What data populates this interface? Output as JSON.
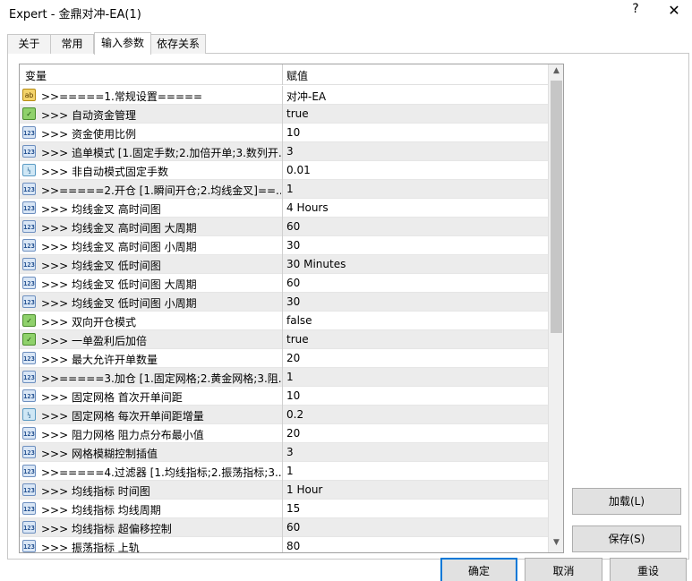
{
  "window": {
    "title": "Expert - 金鼎对冲-EA(1)",
    "help_label": "?",
    "close_label": "✕"
  },
  "tabs": [
    {
      "label": "关于"
    },
    {
      "label": "常用"
    },
    {
      "label": "输入参数"
    },
    {
      "label": "依存关系"
    }
  ],
  "table": {
    "col_variable": "变量",
    "col_value": "赋值",
    "rows": [
      {
        "type": "string",
        "name": ">>=====1.常规设置=====",
        "value": "对冲-EA"
      },
      {
        "type": "bool",
        "name": ">>>  自动资金管理",
        "value": "true"
      },
      {
        "type": "int",
        "name": ">>>  资金使用比例",
        "value": "10"
      },
      {
        "type": "int",
        "name": ">>>  追单模式 [1.固定手数;2.加倍开单;3.数列开...",
        "value": "3"
      },
      {
        "type": "double",
        "name": ">>>  非自动模式固定手数",
        "value": "0.01"
      },
      {
        "type": "int",
        "name": ">>=====2.开仓 [1.瞬间开仓;2.均线金叉]==...",
        "value": "1"
      },
      {
        "type": "int",
        "name": ">>>  均线金叉 高时间图",
        "value": "4 Hours"
      },
      {
        "type": "int",
        "name": ">>>  均线金叉 高时间图 大周期",
        "value": "60"
      },
      {
        "type": "int",
        "name": ">>>  均线金叉 高时间图 小周期",
        "value": "30"
      },
      {
        "type": "int",
        "name": ">>>  均线金叉 低时间图",
        "value": "30 Minutes"
      },
      {
        "type": "int",
        "name": ">>>  均线金叉 低时间图 大周期",
        "value": "60"
      },
      {
        "type": "int",
        "name": ">>>  均线金叉 低时间图 小周期",
        "value": "30"
      },
      {
        "type": "bool",
        "name": ">>>  双向开仓模式",
        "value": "false"
      },
      {
        "type": "bool",
        "name": ">>>  一单盈利后加倍",
        "value": "true"
      },
      {
        "type": "int",
        "name": ">>>  最大允许开单数量",
        "value": "20"
      },
      {
        "type": "int",
        "name": ">>=====3.加仓 [1.固定网格;2.黄金网格;3.阻...",
        "value": "1"
      },
      {
        "type": "int",
        "name": ">>>  固定网格 首次开单间距",
        "value": "10"
      },
      {
        "type": "double",
        "name": ">>>  固定网格 每次开单间距增量",
        "value": "0.2"
      },
      {
        "type": "int",
        "name": ">>>  阻力网格 阻力点分布最小值",
        "value": "20"
      },
      {
        "type": "int",
        "name": ">>>  网格模糊控制插值",
        "value": "3"
      },
      {
        "type": "int",
        "name": ">>=====4.过滤器 [1.均线指标;2.振荡指标;3....",
        "value": "1"
      },
      {
        "type": "int",
        "name": ">>>  均线指标 时间图",
        "value": "1 Hour"
      },
      {
        "type": "int",
        "name": ">>>  均线指标 均线周期",
        "value": "15"
      },
      {
        "type": "int",
        "name": ">>>  均线指标 超偏移控制",
        "value": "60"
      },
      {
        "type": "int",
        "name": ">>>  振荡指标 上轨",
        "value": "80"
      }
    ]
  },
  "icons": {
    "string": "ab",
    "bool": "✓",
    "int": "123",
    "double": "½"
  },
  "scroll": {
    "up": "▲",
    "down": "▼"
  },
  "buttons": {
    "load": "加载(L)",
    "save": "保存(S)",
    "ok": "确定",
    "cancel": "取消",
    "reset": "重设"
  },
  "colors": {
    "primary_border": "#0078d7",
    "alt_row": "#ececec"
  }
}
